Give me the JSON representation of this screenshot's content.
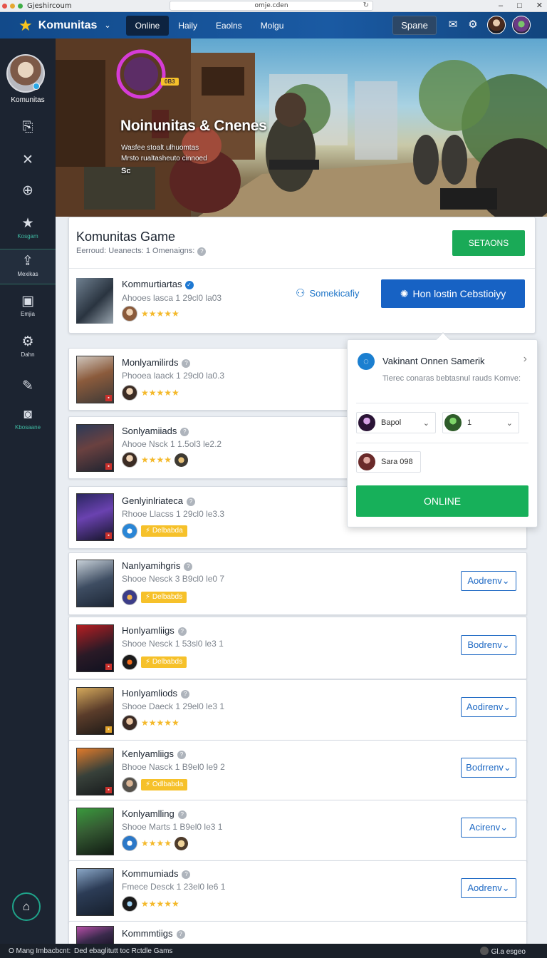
{
  "browser": {
    "tab_title": "Gjeshircoum",
    "url": "omje.cden",
    "window_buttons": [
      "–",
      "□",
      "✕"
    ]
  },
  "topnav": {
    "brand": "Komunitas",
    "tabs": [
      {
        "label": "Online",
        "active": true
      },
      {
        "label": "Haily",
        "active": false
      },
      {
        "label": "Eaolns",
        "active": false
      },
      {
        "label": "Molgu",
        "active": false
      }
    ],
    "search_label": "Spane",
    "accent": "#1a5aa3"
  },
  "sidebar": {
    "user_name": "Komunitas",
    "items": [
      {
        "icon": "clipboard-icon",
        "glyph": "⎘",
        "label": ""
      },
      {
        "icon": "close-x-icon",
        "glyph": "✕",
        "label": ""
      },
      {
        "icon": "globe-icon",
        "glyph": "⊕",
        "label": ""
      },
      {
        "icon": "star-icon",
        "glyph": "★",
        "label": "Kosgam"
      },
      {
        "icon": "upload-icon",
        "glyph": "⇪",
        "label": "Mexikas",
        "active": true
      },
      {
        "icon": "chart-icon",
        "glyph": "▣",
        "label": "Emjia"
      },
      {
        "icon": "gear-icon",
        "glyph": "⚙",
        "label": "Dahn"
      },
      {
        "icon": "wrench-icon",
        "glyph": "✎",
        "label": ""
      },
      {
        "icon": "bag-icon",
        "glyph": "◙",
        "label": "Kbosaane"
      }
    ],
    "home_icon": "home-icon"
  },
  "hero": {
    "tag": "0B3",
    "title": "Noinunitas & Cnenes",
    "sub1": "Wasfee stoalt ulhuomtas",
    "sub2": "Mrsto rualtasheuto cinnoed",
    "sub3": "Sc"
  },
  "game": {
    "title": "Komunitas Game",
    "subtitle": "Eerroud: Ueanects: 1 Omenaigns:",
    "settings_label": "SETAONS",
    "featured": {
      "name": "Kommurtiartas",
      "meta": "Ahooes lasca 1 29cl0 la03",
      "stars": "★★★★★"
    },
    "follow_label": "Somekicafiy",
    "cta_label": "Hon lostin Cebstioiyy"
  },
  "rows": [
    {
      "title": "Monlyamilirds",
      "meta": "Phooea laack 1 29cl0 la0.3",
      "extra": "stars",
      "stars": "★★★★★",
      "button": ""
    },
    {
      "title": "Sonlyamiiads",
      "meta": "Ahooe Nsck 1 1.5ol3 le2.2",
      "extra": "stars",
      "stars": "★★★★",
      "button": ""
    },
    {
      "title": "Genlyinlriateca",
      "meta": "Rhooe Llacss 1 29cl0 le3.3",
      "extra": "pill",
      "pill": "Delbabda",
      "button": ""
    },
    {
      "title": "Nanlyamihgris",
      "meta": "Shooe Nesck 3 B9cl0 le0 7",
      "extra": "pill",
      "pill": "Delbabds",
      "button": "Aodrenv"
    },
    {
      "title": "Honlyamliigs",
      "meta": "Shooe Nesck 1 53sl0 le3 1",
      "extra": "pill",
      "pill": "Delbabds",
      "button": "Bodrenv"
    },
    {
      "title": "Honlyamliods",
      "meta": "Shooe Daeck 1 29el0 le3 1",
      "extra": "stars",
      "stars": "★★★★★",
      "button": "Aodirenv"
    },
    {
      "title": "Kenlyamliigs",
      "meta": "Bhooe Nasck 1 B9el0 le9 2",
      "extra": "pill",
      "pill": "Odlbabda",
      "button": "Bodrrenv"
    },
    {
      "title": "Konlyamlling",
      "meta": "Shooe Marts 1 B9el0 le3 1",
      "extra": "stars",
      "stars": "★★★★",
      "button": "Acirenv"
    },
    {
      "title": "Kommumiads",
      "meta": "Fmece Desck 1 23el0 le6 1",
      "extra": "stars",
      "stars": "★★★★★",
      "button": "Aodrenv"
    },
    {
      "title": "Kommmtiigs",
      "meta": "",
      "extra": "none",
      "button": ""
    }
  ],
  "popup": {
    "title": "Vakinant Onnen Samerik",
    "description": "Tierec conaras bebtasnul rauds Komve:",
    "select1": "Bapol",
    "select2": "1",
    "chip": "Sara 098",
    "online_label": "ONLINE"
  },
  "statusbar": {
    "left": "O Mang Imbacbcnt:",
    "middle": "Ded  ebaglitutt toc Rctdle Gams",
    "right": "Gl.a esgeo"
  }
}
